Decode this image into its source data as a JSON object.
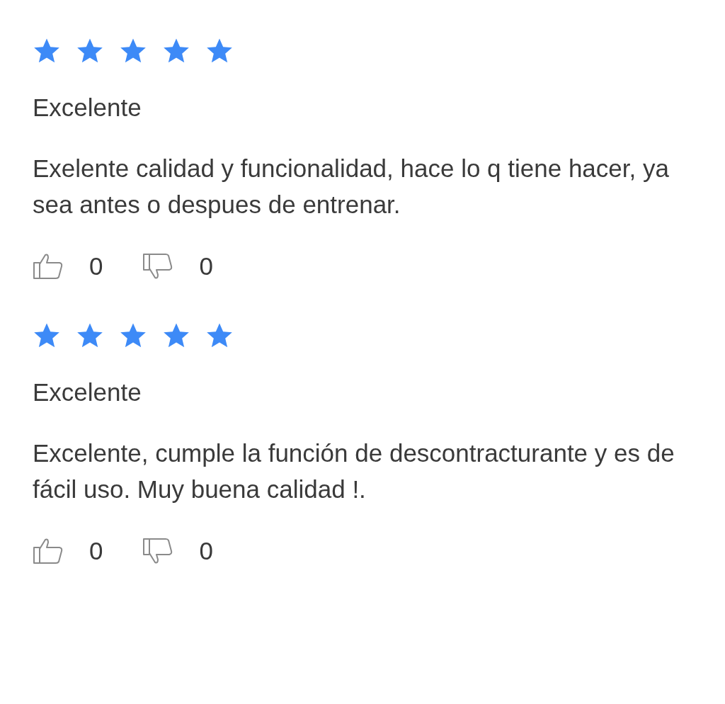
{
  "reviews": [
    {
      "stars": 5,
      "title": "Excelente",
      "body": "Exelente calidad y funcionalidad, hace lo q tiene hacer, ya sea antes o despues de entrenar.",
      "likes": "0",
      "dislikes": "0"
    },
    {
      "stars": 5,
      "title": "Excelente",
      "body": "Excelente, cumple la función de descontracturante y es de fácil uso. Muy buena calidad !.",
      "likes": "0",
      "dislikes": "0"
    }
  ]
}
